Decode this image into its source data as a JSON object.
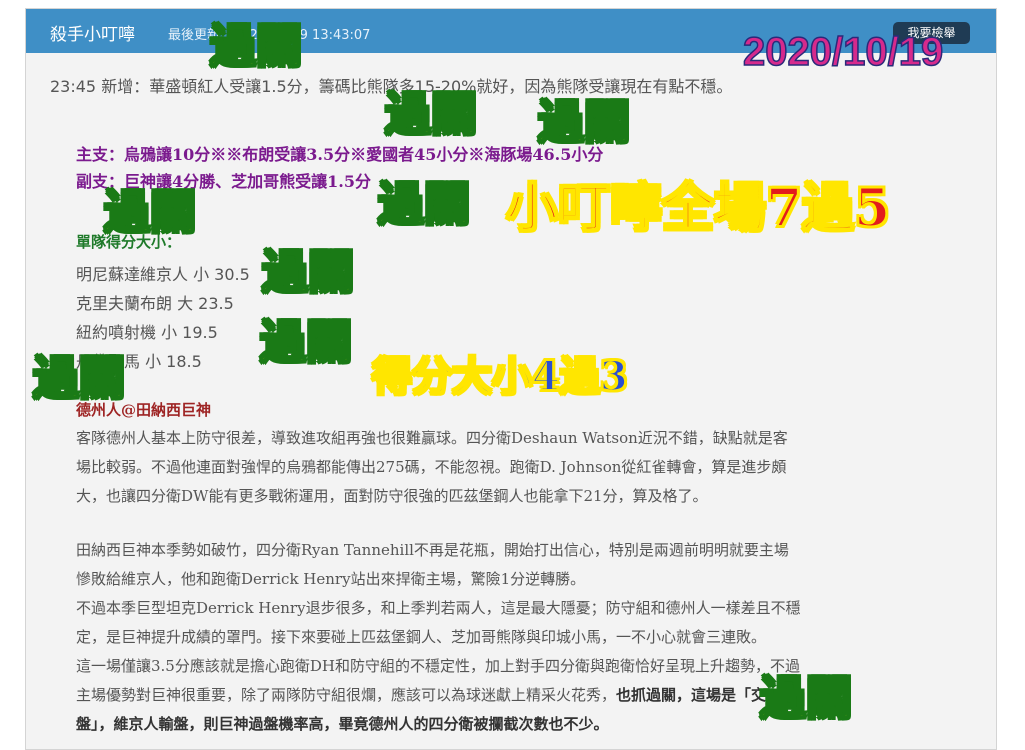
{
  "header": {
    "title": "殺手小叮嚀",
    "updated": "最後更新：2020/10/19 13:43:07",
    "report_button": "我要檢舉"
  },
  "content": {
    "update_note": "23:45 新增：華盛頓紅人受讓1.5分，籌碼比熊隊多15-20%就好，因為熊隊受讓現在有點不穩。",
    "main_pick": "主支：烏鴉讓10分※※布朗受讓3.5分※愛國者45小分※海豚場46.5小分",
    "sub_pick": "副支：巨神讓4分勝、芝加哥熊受讓1.5分",
    "totals_heading": "單隊得分大小：",
    "totals": [
      "明尼蘇達維京人 小 30.5",
      "克里夫蘭布朗 大 23.5",
      "紐約噴射機 小 19.5",
      "丹佛野馬 小 18.5"
    ],
    "matchup_heading": "德州人@田納西巨神",
    "paragraphs": [
      "客隊德州人基本上防守很差，導致進攻組再強也很難贏球。四分衛Deshaun Watson近況不錯，缺點就是客",
      "場比較弱。不過他連面對強悍的烏鴉都能傳出275碼，不能忽視。跑衛D. Johnson從紅雀轉會，算是進步頗",
      "大，也讓四分衛DW能有更多戰術運用，面對防守很強的匹茲堡鋼人也能拿下21分，算及格了。",
      "田納西巨神本季勢如破竹，四分衛Ryan Tannehill不再是花瓶，開始打出信心，特別是兩週前明明就要主場",
      "慘敗給維京人，他和跑衛Derrick Henry站出來捍衛主場，驚險1分逆轉勝。",
      "不過本季巨型坦克Derrick Henry退步很多，和上季判若兩人，這是最大隱憂；防守組和德州人一樣差且不穩",
      "定，是巨神提升成績的罩門。接下來要碰上匹茲堡鋼人、芝加哥熊隊與印城小馬，一不小心就會三連敗。",
      "這一場僅讓3.5分應該就是擔心跑衛DH和防守組的不穩定性，加上對手四分衛與跑衛恰好呈現上升趨勢，不過",
      "主場優勢對巨神很重要，除了兩隊防守組很爛，應該可以為球迷獻上精采火花秀，"
    ],
    "bold_tail": "也抓過關，這場是「交叉",
    "bold_line": "盤」，維京人輸盤，則巨神過盤機率高，畢竟德州人的四分衛被攔截次數也不少。"
  },
  "overlays": {
    "date": "2020/10/19",
    "pass": "過關",
    "headline": "小叮嚀全場7過5",
    "score_note": "得分大小4過3"
  }
}
